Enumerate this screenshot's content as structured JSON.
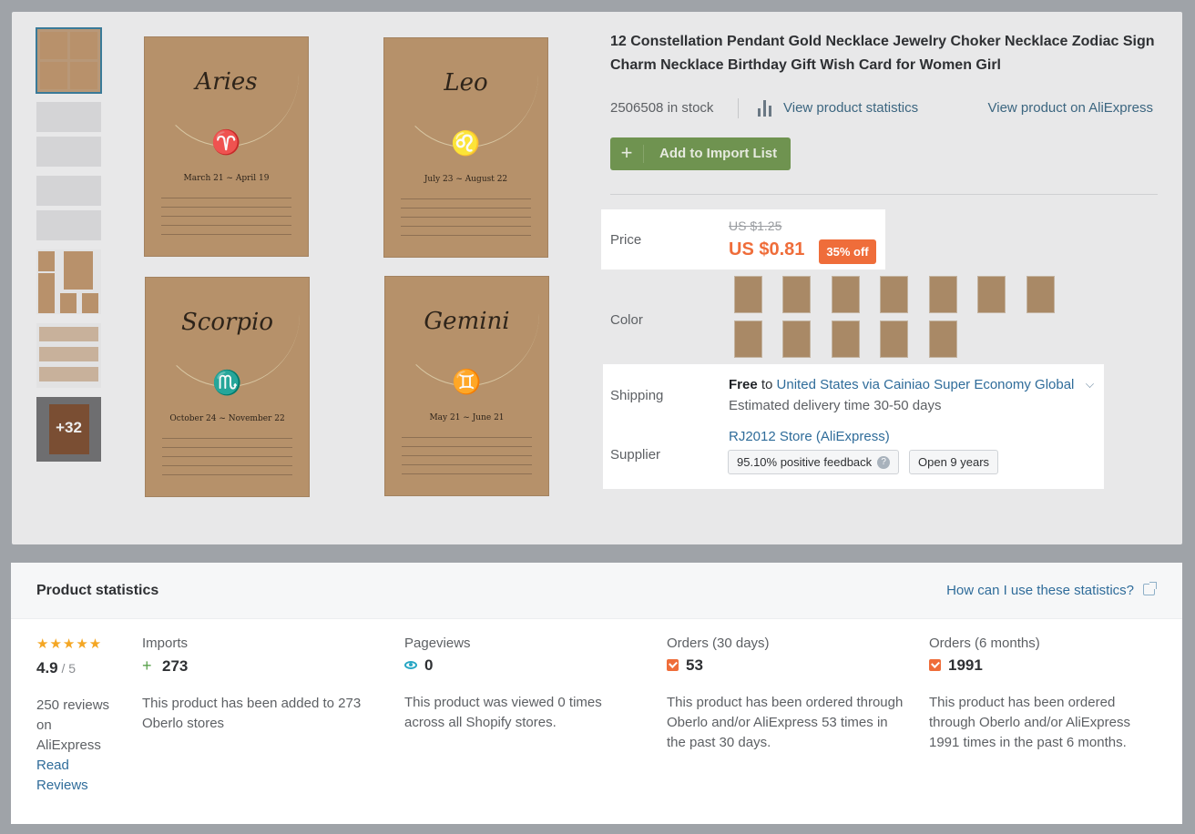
{
  "product": {
    "title": "12 Constellation Pendant Gold Necklace Jewelry Choker Necklace Zodiac Sign Charm Necklace Birthday Gift Wish Card for Women Girl",
    "stock": "2506508 in stock",
    "stats_link": "View product statistics",
    "aliexpress_link": "View product on AliExpress",
    "import_button": "Add to Import List",
    "import_plus": "+",
    "more_images": "+32",
    "gallery": [
      {
        "name": "Aries",
        "glyph": "♈",
        "dates": "March 21 ~ April 19"
      },
      {
        "name": "Leo",
        "glyph": "♌",
        "dates": "July 23 ~ August 22"
      },
      {
        "name": "Scorpio",
        "glyph": "♏",
        "dates": "October 24 ~ November 22"
      },
      {
        "name": "Gemini",
        "glyph": "♊",
        "dates": "May 21 ~ June 21"
      }
    ]
  },
  "price": {
    "label": "Price",
    "original": "US $1.25",
    "current": "US $0.81",
    "discount": "35% off"
  },
  "color": {
    "label": "Color",
    "swatch_count": 12
  },
  "shipping": {
    "label": "Shipping",
    "free": "Free",
    "to": " to ",
    "destination": "United States via Cainiao Super Economy Global",
    "delivery": "Estimated delivery time 30-50 days"
  },
  "supplier": {
    "label": "Supplier",
    "store": "RJ2012 Store (AliExpress)",
    "feedback": "95.10% positive feedback",
    "help": "?",
    "open": "Open 9 years"
  },
  "statistics": {
    "title": "Product statistics",
    "help_link": "How can I use these statistics?",
    "rating": {
      "stars": "★★★★★",
      "value": "4.9",
      "max": " / 5",
      "reviews": "250 reviews on AliExpress",
      "read_link": "Read Reviews"
    },
    "imports": {
      "caption": "Imports",
      "icon": "plus-icon",
      "value": "273",
      "description": "This product has been added to 273 Oberlo stores"
    },
    "pageviews": {
      "caption": "Pageviews",
      "icon": "eye-icon",
      "value": "0",
      "description": "This product was viewed 0 times across all Shopify stores."
    },
    "orders_30": {
      "caption": "Orders (30 days)",
      "icon": "cart-icon",
      "value": "53",
      "description": "This product has been ordered through Oberlo and/or AliExpress 53 times in the past 30 days."
    },
    "orders_6m": {
      "caption": "Orders (6 months)",
      "icon": "cart-icon",
      "value": "1991",
      "description": "This product has been ordered through Oberlo and/or AliExpress 1991 times in the past 6 months."
    }
  },
  "colors": {
    "accent_orange": "#ef6d3a",
    "link_blue": "#2f6c9a",
    "import_green": "#6f9350",
    "star": "#f4a623",
    "overlay": "#9fa3a8"
  }
}
